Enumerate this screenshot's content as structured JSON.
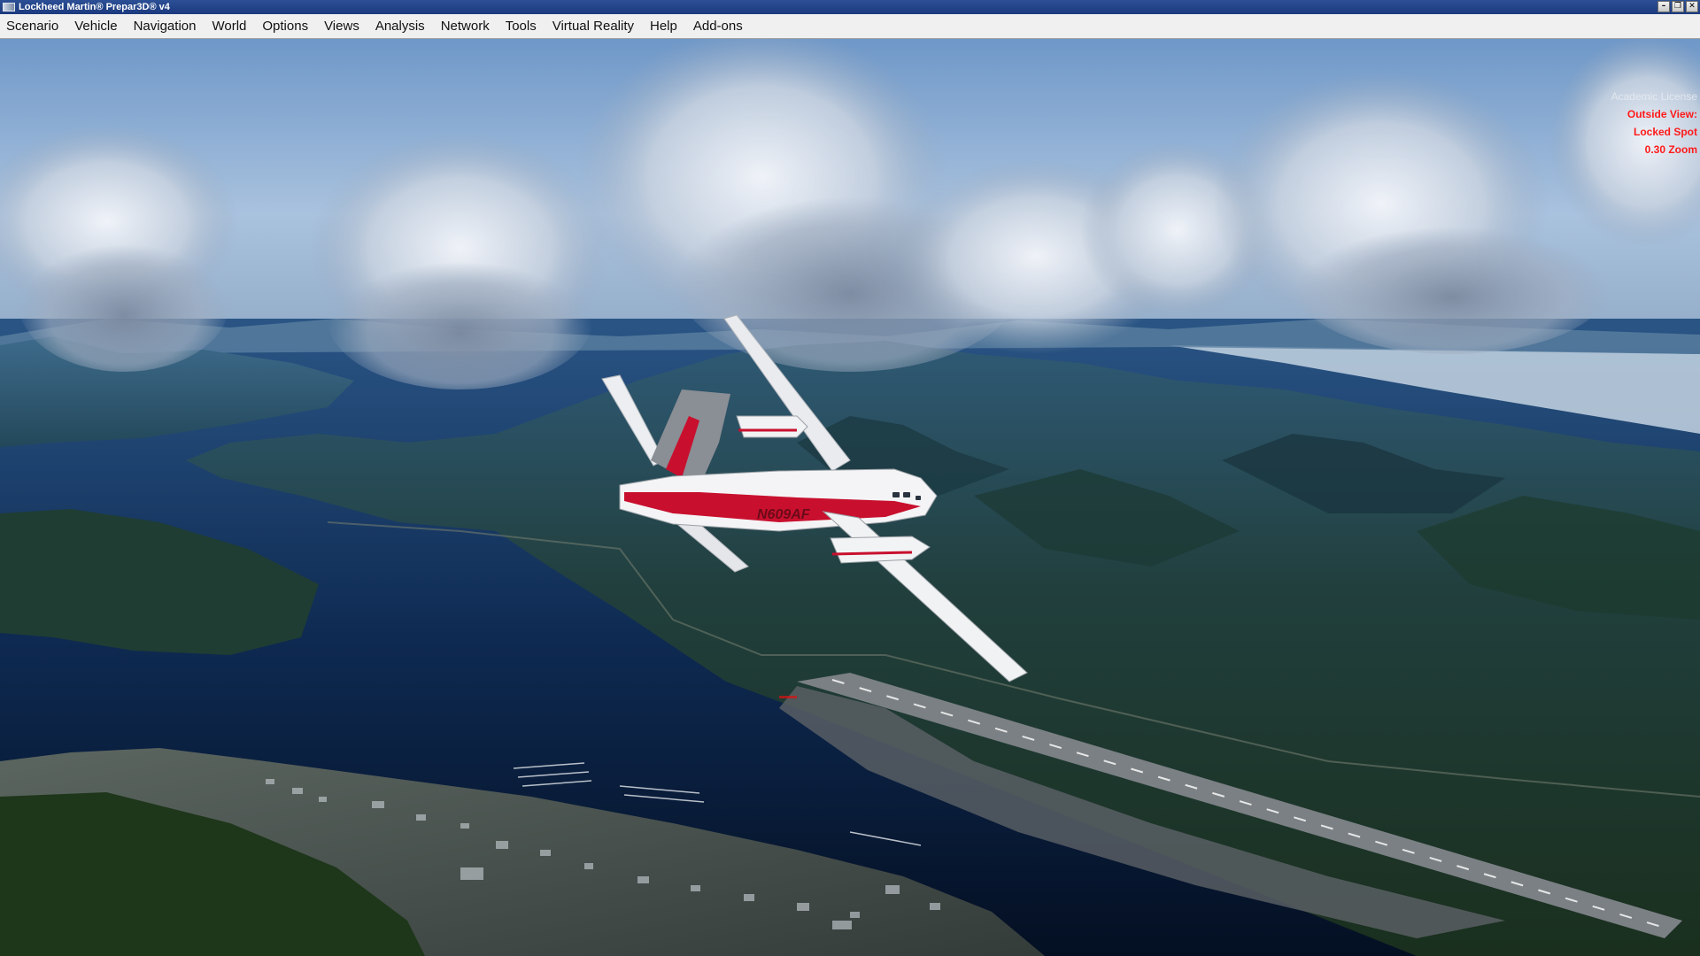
{
  "window": {
    "title": "Lockheed Martin® Prepar3D® v4",
    "controls": [
      "minimize",
      "restore",
      "close"
    ]
  },
  "menu": {
    "items": [
      "Scenario",
      "Vehicle",
      "Navigation",
      "World",
      "Options",
      "Views",
      "Analysis",
      "Network",
      "Tools",
      "Virtual Reality",
      "Help",
      "Add-ons"
    ]
  },
  "overlay": {
    "license": "Academic License",
    "view": "Outside View:",
    "mode": "Locked Spot",
    "zoom": "0.30 Zoom"
  },
  "aircraft": {
    "registration": "N609AF",
    "livery_colors": {
      "body": "#f4f4f6",
      "stripe": "#c8102e",
      "tail_grey": "#8a8e95"
    }
  },
  "icons": {
    "app": "prepar3d-app-icon",
    "minimize": "minimize-icon",
    "restore": "restore-icon",
    "close": "close-icon"
  }
}
